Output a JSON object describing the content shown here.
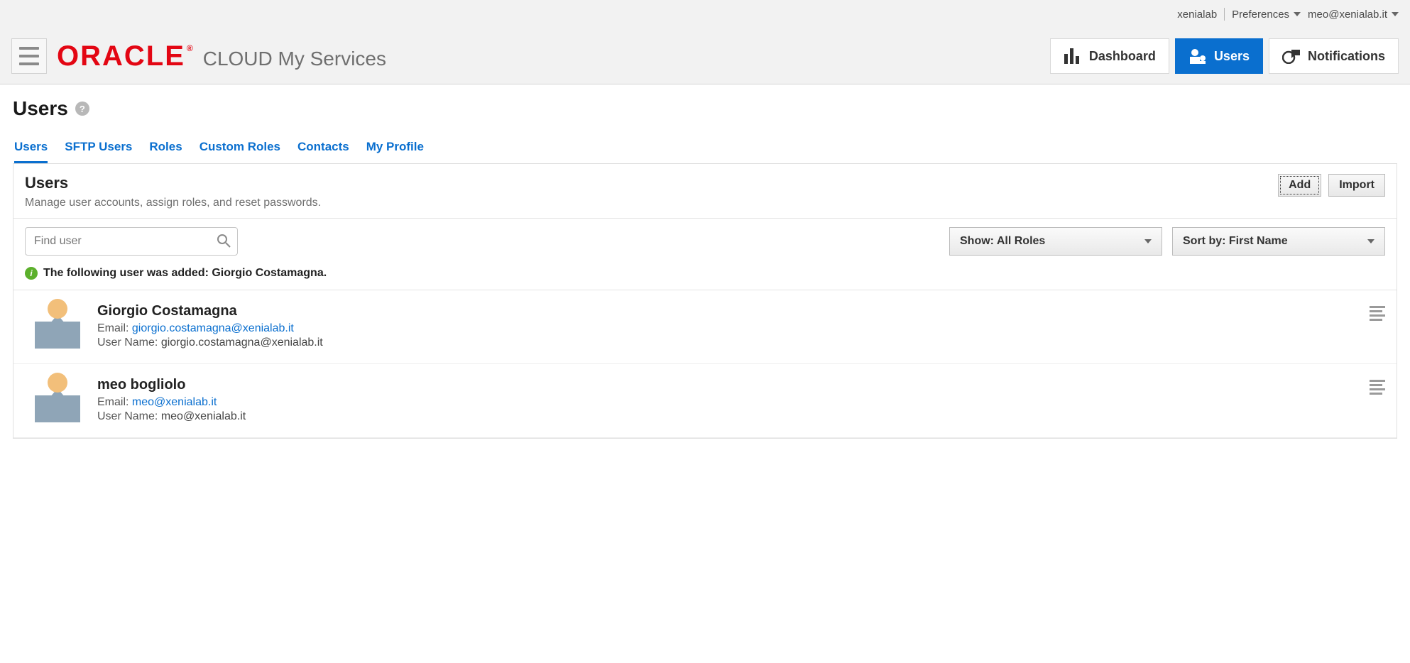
{
  "header": {
    "account": "xenialab",
    "prefs_label": "Preferences",
    "email": "meo@xenialab.it",
    "logo_text": "ORACLE",
    "product_line": "CLOUD My Services",
    "nav": {
      "dashboard": "Dashboard",
      "users": "Users",
      "notifications": "Notifications"
    }
  },
  "page": {
    "title": "Users",
    "tabs": [
      {
        "label": "Users",
        "active": true
      },
      {
        "label": "SFTP Users",
        "active": false
      },
      {
        "label": "Roles",
        "active": false
      },
      {
        "label": "Custom Roles",
        "active": false
      },
      {
        "label": "Contacts",
        "active": false
      },
      {
        "label": "My Profile",
        "active": false
      }
    ]
  },
  "panel": {
    "heading": "Users",
    "subheading": "Manage user accounts, assign roles, and reset passwords.",
    "actions": {
      "add": "Add",
      "import": "Import"
    }
  },
  "filters": {
    "search_placeholder": "Find user",
    "show_label": "Show: All Roles",
    "sort_label": "Sort by: First Name"
  },
  "notice": {
    "text": "The following user was added: Giorgio Costamagna."
  },
  "users": [
    {
      "name": "Giorgio Costamagna",
      "email_label": "Email:",
      "email": "giorgio.costamagna@xenialab.it",
      "username_label": "User Name:",
      "username": "giorgio.costamagna@xenialab.it"
    },
    {
      "name": "meo bogliolo",
      "email_label": "Email:",
      "email": "meo@xenialab.it",
      "username_label": "User Name:",
      "username": "meo@xenialab.it"
    }
  ]
}
